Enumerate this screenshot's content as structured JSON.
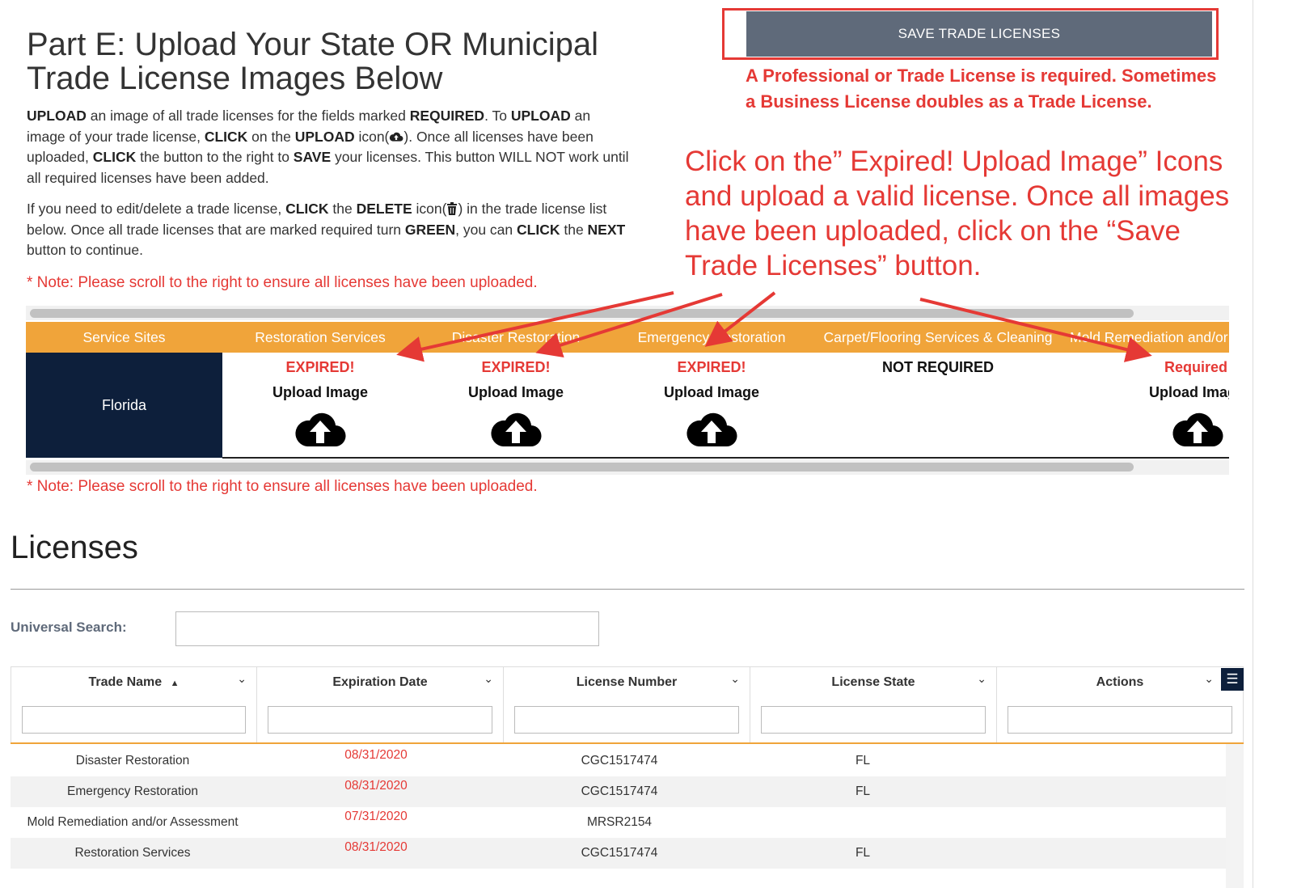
{
  "page": {
    "title": "Part E: Upload Your State OR Municipal Trade License Images Below",
    "instructions1": {
      "t1": "UPLOAD",
      "t2": " an image of all trade licenses for the fields marked ",
      "t3": "REQUIRED",
      "t4": ". To ",
      "t5": "UPLOAD",
      "t6": " an image of your trade license, ",
      "t7": "CLICK",
      "t8": " on the ",
      "t9": "UPLOAD",
      "t10": " icon(",
      "t11": "). Once all licenses have been uploaded, ",
      "t12": "CLICK",
      "t13": " the button to the right to ",
      "t14": "SAVE",
      "t15": " your licenses. This button WILL NOT work until all required licenses have been added."
    },
    "instructions2": {
      "t1": "If you need to edit/delete a trade license, ",
      "t2": "CLICK",
      "t3": " the ",
      "t4": "DELETE",
      "t5": " icon(",
      "t6": ") in the trade license list below. Once all trade licenses that are marked required turn ",
      "t7": "GREEN",
      "t8": ", you can ",
      "t9": "CLICK",
      "t10": " the ",
      "t11": "NEXT",
      "t12": " button to continue."
    },
    "scroll_note": "* Note: Please scroll to the right to ensure all licenses have been uploaded.",
    "save_button": "SAVE TRADE LICENSES",
    "required_note": "A Professional or Trade License is required. Sometimes a Business License doubles as a Trade License.",
    "annotation": "Click on the” Expired! Upload Image” Icons and upload a valid license. Once all images have been uploaded, click on the “Save Trade Licenses” button."
  },
  "upload_grid": {
    "headers": [
      "Service Sites",
      "Restoration Services",
      "Disaster Restoration",
      "Emergency Restoration",
      "Carpet/Flooring Services & Cleaning",
      "Mold Remediation and/or Assessment"
    ],
    "site": "Florida",
    "cells": [
      {
        "status": "EXPIRED!",
        "upload": "Upload Image",
        "status_color": "#e53935"
      },
      {
        "status": "EXPIRED!",
        "upload": "Upload Image",
        "status_color": "#e53935"
      },
      {
        "status": "EXPIRED!",
        "upload": "Upload Image",
        "status_color": "#e53935"
      },
      {
        "status": "NOT REQUIRED",
        "upload": "",
        "status_color": "#111111"
      },
      {
        "status": "Required",
        "upload": "Upload Image",
        "status_color": "#e53935"
      }
    ],
    "upload_icon": "cloud-upload-icon"
  },
  "licenses": {
    "heading": "Licenses",
    "search_label": "Universal Search:",
    "columns": [
      "Trade Name",
      "Expiration Date",
      "License Number",
      "License State",
      "Actions"
    ],
    "sort_indicator": "▲",
    "rows": [
      {
        "trade_name": "Disaster Restoration",
        "expiration": "08/31/2020",
        "number": "CGC1517474",
        "state": "FL"
      },
      {
        "trade_name": "Emergency Restoration",
        "expiration": "08/31/2020",
        "number": "CGC1517474",
        "state": "FL"
      },
      {
        "trade_name": "Mold Remediation and/or Assessment",
        "expiration": "07/31/2020",
        "number": "MRSR2154",
        "state": ""
      },
      {
        "trade_name": "Restoration Services",
        "expiration": "08/31/2020",
        "number": "CGC1517474",
        "state": "FL"
      }
    ]
  },
  "colors": {
    "accent_orange": "#f0a43a",
    "navy": "#0d1f3b",
    "button_gray": "#5f6a7a",
    "alert_red": "#e53935",
    "green": "#2e7d32"
  }
}
